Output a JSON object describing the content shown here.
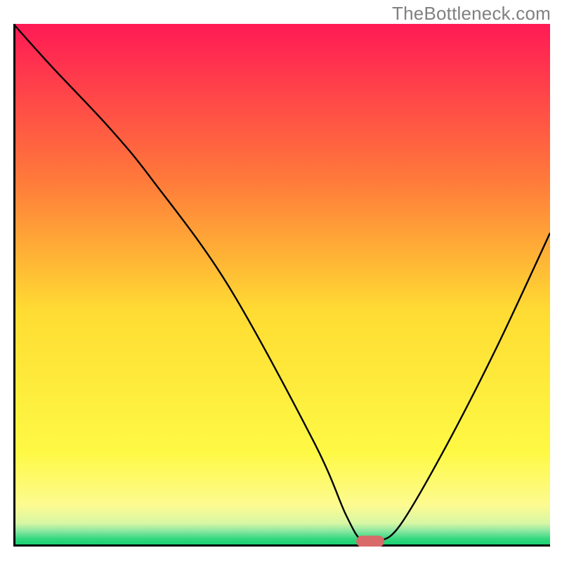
{
  "watermark": "TheBottleneck.com",
  "chart_data": {
    "type": "line",
    "title": "",
    "xlabel": "",
    "ylabel": "",
    "xlim": [
      0,
      100
    ],
    "ylim": [
      0,
      100
    ],
    "grid": false,
    "legend": false,
    "gradient_bands": [
      {
        "y_norm": 0.0,
        "color": "#ff1a55"
      },
      {
        "y_norm": 0.3,
        "color": "#ff7a3a"
      },
      {
        "y_norm": 0.55,
        "color": "#ffdc33"
      },
      {
        "y_norm": 0.82,
        "color": "#fef944"
      },
      {
        "y_norm": 0.92,
        "color": "#fdfb90"
      },
      {
        "y_norm": 0.955,
        "color": "#d9f7a4"
      },
      {
        "y_norm": 0.97,
        "color": "#8de8a1"
      },
      {
        "y_norm": 0.985,
        "color": "#34d87f"
      },
      {
        "y_norm": 1.0,
        "color": "#0fcf6b"
      }
    ],
    "series": [
      {
        "name": "bottleneck-curve",
        "x": [
          0,
          7,
          18,
          26,
          40,
          56,
          62,
          65,
          68,
          72,
          80,
          90,
          100
        ],
        "values": [
          100,
          92,
          80,
          70,
          50,
          20,
          6,
          1,
          1,
          4,
          18,
          38,
          60
        ]
      }
    ],
    "marker": {
      "name": "optimal-point",
      "x": 66.5,
      "y": 1.0,
      "color": "#d86a6a",
      "rx": 20,
      "ry": 8
    },
    "axes": {
      "left": {
        "x_norm": 0.0
      },
      "bottom": {
        "y_norm": 1.0
      }
    }
  }
}
